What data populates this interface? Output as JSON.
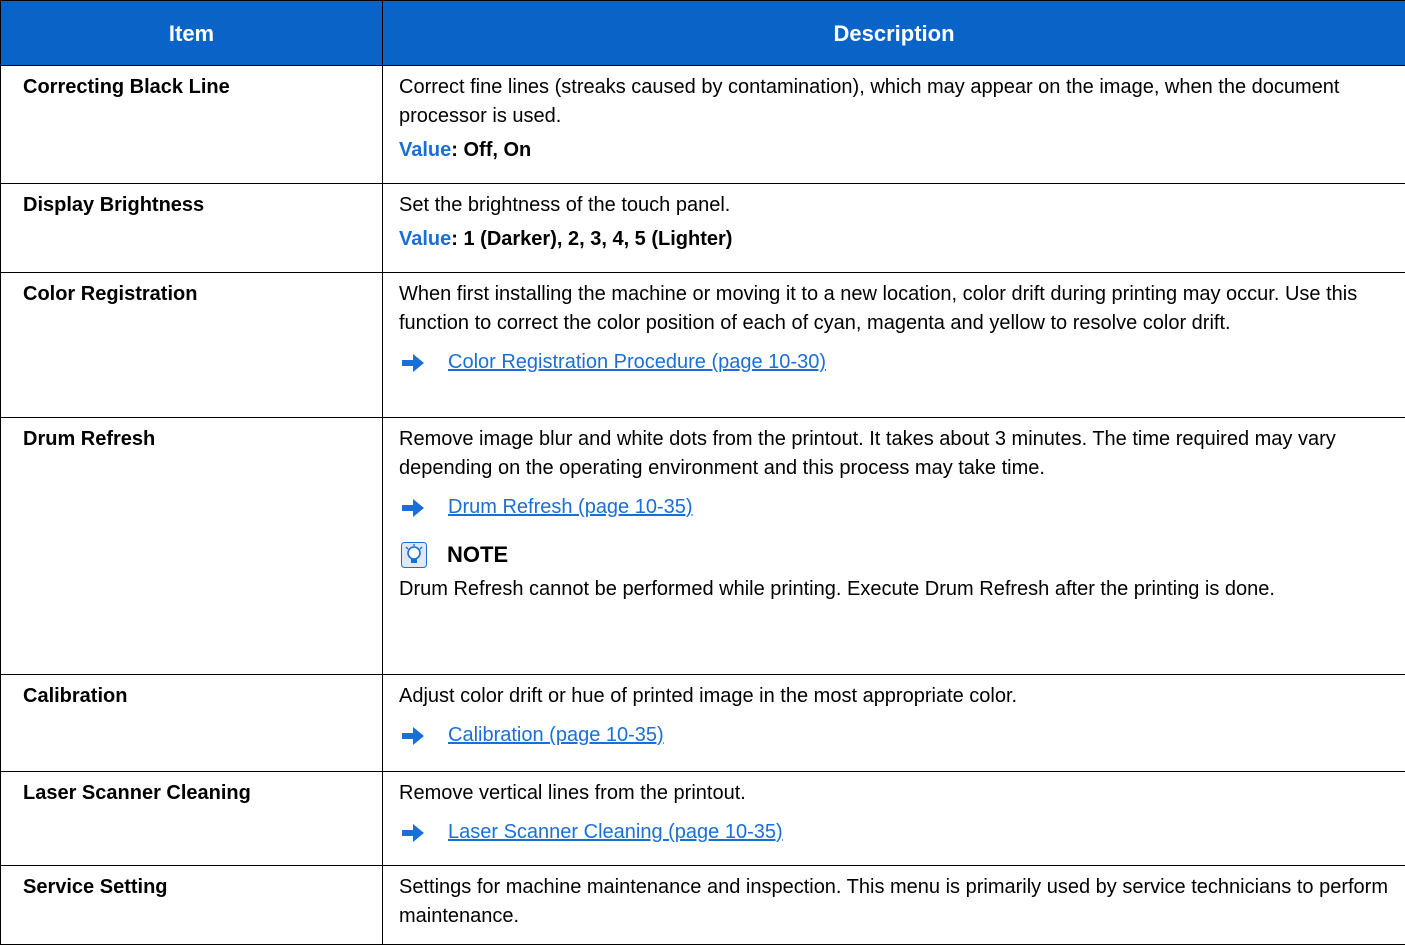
{
  "table": {
    "header_item": "Item",
    "header_description": "Description"
  },
  "colors": {
    "header_bg": "#0a64c8",
    "accent": "#1a6fd6",
    "border": "#000000"
  },
  "icons": {
    "reference_arrow": "right-arrow-icon",
    "note": "note-lightbulb-icon"
  },
  "rows": {
    "correcting_black_line": {
      "item": "Correcting Black Line",
      "description": "Correct fine lines (streaks caused by contamination), which may appear on the image, when the document processor is used.",
      "value_label": "Value",
      "value_text": ": Off, On"
    },
    "display_brightness": {
      "item": "Display Brightness",
      "description": "Set the brightness of the touch panel.",
      "value_label": "Value",
      "value_text": ": 1 (Darker), 2, 3, 4, 5 (Lighter)"
    },
    "color_registration": {
      "item": "Color Registration",
      "description": "When first installing the machine or moving it to a new location, color drift during printing may occur. Use this function to correct the color position of each of cyan, magenta and yellow to resolve color drift.",
      "link": "Color Registration Procedure (page 10-30)"
    },
    "drum_refresh": {
      "item": "Drum Refresh",
      "description": "Remove image blur and white dots from the printout. It takes about 3 minutes. The time required may vary depending on the operating environment and this process may take time.",
      "link": "Drum Refresh (page 10-35)",
      "note_title": "NOTE",
      "note_text": "Drum Refresh cannot be performed while printing. Execute Drum Refresh after the printing is done."
    },
    "calibration": {
      "item": "Calibration",
      "description": "Adjust color drift or hue of printed image in the most appropriate color.",
      "link": "Calibration (page 10-35)"
    },
    "laser_scanner_cleaning": {
      "item": "Laser Scanner Cleaning",
      "description": "Remove vertical lines from the printout.",
      "link": "Laser Scanner Cleaning (page 10-35)"
    },
    "service_setting": {
      "item": "Service Setting",
      "description": "Settings for machine maintenance and inspection. This menu is primarily used by service technicians to perform maintenance."
    }
  }
}
